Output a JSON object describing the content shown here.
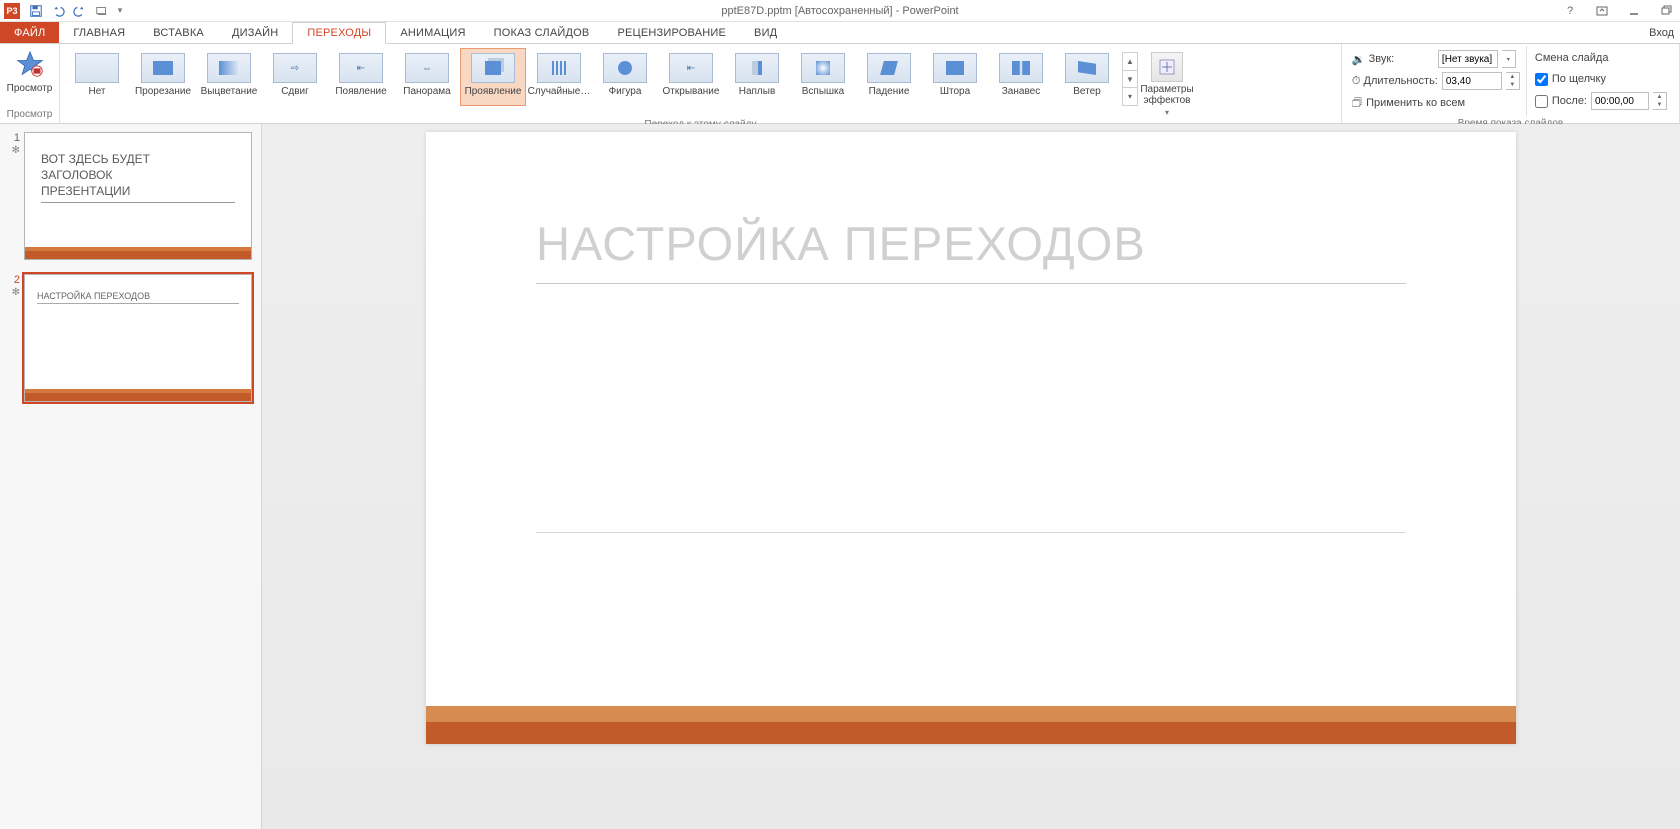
{
  "title": "pptE87D.pptm [Автосохраненный] - PowerPoint",
  "app_badge": "P3",
  "signin": "Вход",
  "tabs": {
    "file": "ФАЙЛ",
    "home": "ГЛАВНАЯ",
    "insert": "ВСТАВКА",
    "design": "ДИЗАЙН",
    "transitions": "ПЕРЕХОДЫ",
    "animation": "АНИМАЦИЯ",
    "slideshow": "ПОКАЗ СЛАЙДОВ",
    "review": "РЕЦЕНЗИРОВАНИЕ",
    "view": "ВИД"
  },
  "preview": {
    "button": "Просмотр",
    "group": "Просмотр"
  },
  "gallery": {
    "items": [
      {
        "label": "Нет"
      },
      {
        "label": "Прорезание"
      },
      {
        "label": "Выцветание"
      },
      {
        "label": "Сдвиг"
      },
      {
        "label": "Появление"
      },
      {
        "label": "Панорама"
      },
      {
        "label": "Проявление"
      },
      {
        "label": "Случайные…"
      },
      {
        "label": "Фигура"
      },
      {
        "label": "Открывание"
      },
      {
        "label": "Наплыв"
      },
      {
        "label": "Вспышка"
      },
      {
        "label": "Падение"
      },
      {
        "label": "Штора"
      },
      {
        "label": "Занавес"
      },
      {
        "label": "Ветер"
      }
    ],
    "effect_options": "Параметры эффектов",
    "group": "Переход к этому слайду"
  },
  "timing": {
    "sound_label": "Звук:",
    "sound_value": "[Нет звука]",
    "duration_label": "Длительность:",
    "duration_value": "03,40",
    "apply_all": "Применить ко всем",
    "group": "Время показа слайдов"
  },
  "advance": {
    "title": "Смена слайда",
    "on_click": "По щелчку",
    "after": "После:",
    "after_value": "00:00,00"
  },
  "thumbs": {
    "slide1": {
      "num": "1",
      "line1": "ВОТ ЗДЕСЬ БУДЕТ",
      "line2": "ЗАГОЛОВОК",
      "line3": "ПРЕЗЕНТАЦИИ"
    },
    "slide2": {
      "num": "2",
      "title": "НАСТРОЙКА ПЕРЕХОДОВ"
    }
  },
  "canvas": {
    "title": "НАСТРОЙКА ПЕРЕХОДОВ"
  }
}
